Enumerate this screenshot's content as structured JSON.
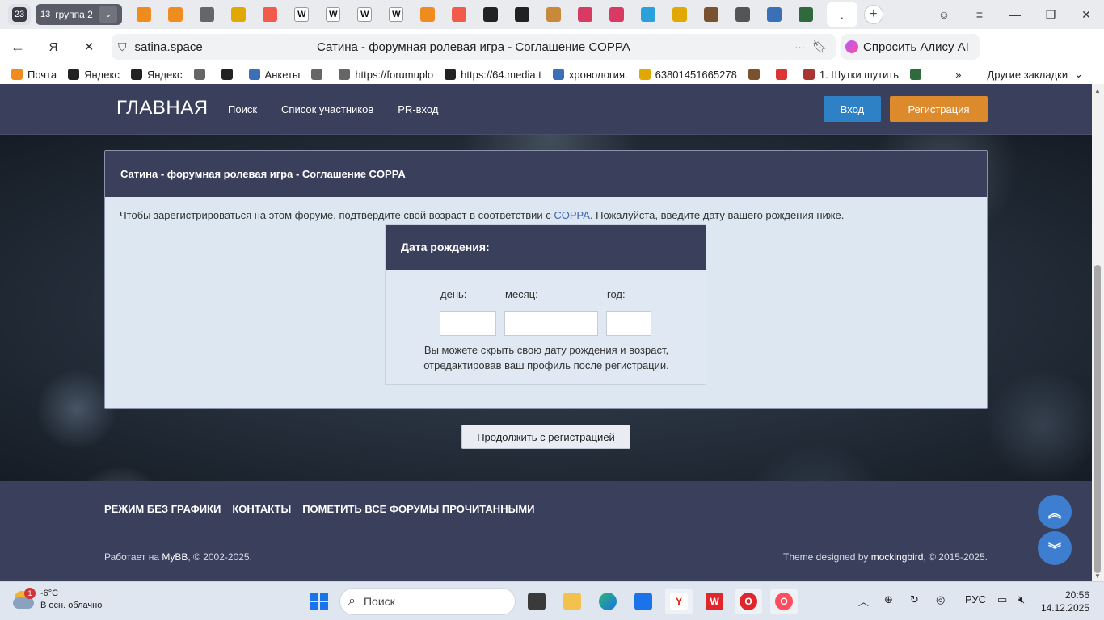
{
  "browser": {
    "tab_count": "23",
    "group_count": "13",
    "group_name": "группа 2",
    "active_tab_title": ".",
    "url_domain": "satina.space",
    "page_title": "Сатина - форумная ролевая игра - Соглашение COPPA",
    "alice_label": "Спросить Алису AI",
    "tab_icons": [
      "mail-icon",
      "mail-icon",
      "document-icon",
      "image-icon",
      "yandex-icon",
      "wikipedia-icon",
      "wikipedia-icon",
      "wikipedia-icon",
      "wikipedia-icon",
      "mail-icon",
      "yandex-icon",
      "sparkle-icon",
      "sparkle-icon",
      "painting-icon",
      "opera-icon",
      "opera-icon",
      "telegram-icon",
      "image-icon",
      "avatar-icon",
      "gear-icon",
      "forum-icon",
      "book-icon"
    ],
    "colors": {
      "tabstrip_bg": "#e9ebef",
      "group_bg": "#5a5d67"
    }
  },
  "bookmarks": {
    "items": [
      {
        "label": "Почта",
        "icon": "mail-icon"
      },
      {
        "label": "Яндекс",
        "icon": "sparkle-icon"
      },
      {
        "label": "Яндекс",
        "icon": "sparkle-icon"
      },
      {
        "label": "",
        "icon": "document-icon"
      },
      {
        "label": "",
        "icon": "sparkle-icon"
      },
      {
        "label": "Анкеты",
        "icon": "forum-icon"
      },
      {
        "label": "",
        "icon": "document-icon"
      },
      {
        "label": "https://forumuplo",
        "icon": "document-icon"
      },
      {
        "label": "https://64.media.t",
        "icon": "tumblr-icon"
      },
      {
        "label": "хронология.",
        "icon": "forum-icon"
      },
      {
        "label": "63801451665278",
        "icon": "image-icon"
      },
      {
        "label": "",
        "icon": "avatar-icon"
      },
      {
        "label": "",
        "icon": "flag-icon"
      },
      {
        "label": "1. Шутки шутить",
        "icon": "feather-icon"
      },
      {
        "label": "",
        "icon": "book-icon"
      }
    ],
    "overflow": "»",
    "other": "Другие закладки"
  },
  "site": {
    "brand": "ГЛАВНАЯ",
    "nav": [
      "Поиск",
      "Список участников",
      "PR-вход"
    ],
    "login": "Вход",
    "register": "Регистрация",
    "colors": {
      "header": "#3a3f5c",
      "login": "#2f81c5",
      "register": "#dd8a2c",
      "link": "#3e63b0"
    }
  },
  "coppa": {
    "heading": "Сатина - форумная ролевая игра - Соглашение COPPA",
    "text_before": "Чтобы зарегистрироваться на этом форуме, подтвердите свой возраст в соответствии с ",
    "link": "COPPA",
    "text_after": ". Пожалуйста, введите дату вашего рождения ниже.",
    "dob_title": "Дата рождения:",
    "day_label": "день:",
    "month_label": "месяц:",
    "year_label": "год:",
    "day_value": "",
    "month_value": "",
    "year_value": "",
    "note_line1": "Вы можете скрыть свою дату рождения и возраст,",
    "note_line2": "отредактировав ваш профиль после регистрации.",
    "continue": "Продолжить с регистрацией"
  },
  "footer": {
    "links": [
      "РЕЖИМ БЕЗ ГРАФИКИ",
      "КОНТАКТЫ",
      "ПОМЕТИТЬ ВСЕ ФОРУМЫ ПРОЧИТАННЫМИ"
    ],
    "powered_prefix": "Работает на ",
    "powered_brand": "MyBB",
    "powered_suffix": ", © 2002-2025.",
    "theme_prefix": "Theme designed by ",
    "theme_brand": "mockingbird",
    "theme_suffix": ", © 2015-2025."
  },
  "taskbar": {
    "weather_badge": "1",
    "temperature": "-6°C",
    "condition": "В осн. облачно",
    "search_placeholder": "Поиск",
    "language": "РУС",
    "time": "20:56",
    "date": "14.12.2025"
  }
}
